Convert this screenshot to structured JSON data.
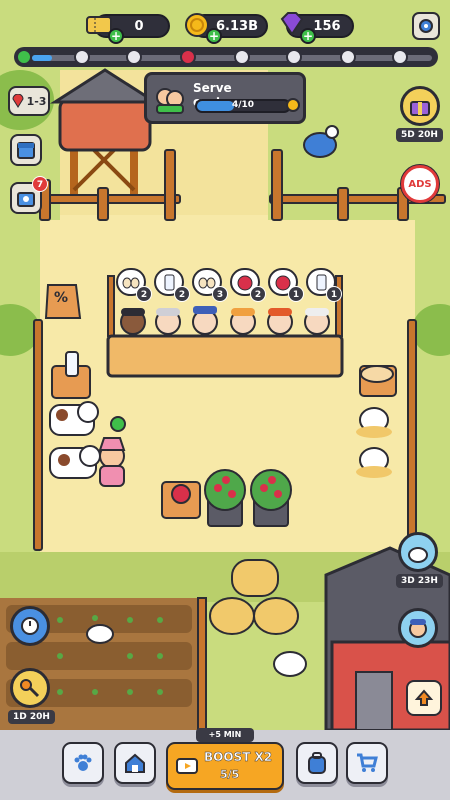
{
  "resources": {
    "tickets": "0",
    "coins": "6.13B",
    "gems": "156"
  },
  "quest": {
    "title": "Serve customers",
    "progress_text": "4/10",
    "progress": 0.4
  },
  "level": {
    "label": "1-3"
  },
  "badges": {
    "shop_notification": "7"
  },
  "customer_orders": [
    {
      "item": "egg",
      "count": "2"
    },
    {
      "item": "milk",
      "count": "2"
    },
    {
      "item": "egg",
      "count": "3"
    },
    {
      "item": "raspberry",
      "count": "2"
    },
    {
      "item": "raspberry",
      "count": "1"
    },
    {
      "item": "milk",
      "count": "1"
    }
  ],
  "timers": {
    "event_top_right": "5D 20H",
    "event_right_mid": "3D 23H",
    "key_event_left": "1D 20H"
  },
  "ads_label": "ADS",
  "percent_sign": "%",
  "boost": {
    "top_label": "+5 MIN",
    "title": "BOOST X2",
    "count": "5/5"
  },
  "colors": {
    "coin": "#f5b91a",
    "gem": "#8a4bd6",
    "ticket": "#f2c84b",
    "boost": "#f6a623",
    "progress_blue": "#3f8fe0"
  },
  "icons": [
    "ticket-icon",
    "coin-icon",
    "gem-icon",
    "gear-icon",
    "map-pin-icon",
    "calendar-icon",
    "shop-icon",
    "paw-icon",
    "home-icon",
    "tv-icon",
    "backpack-icon",
    "cart-icon",
    "arrow-up-icon",
    "no-ads-icon",
    "key-icon"
  ]
}
